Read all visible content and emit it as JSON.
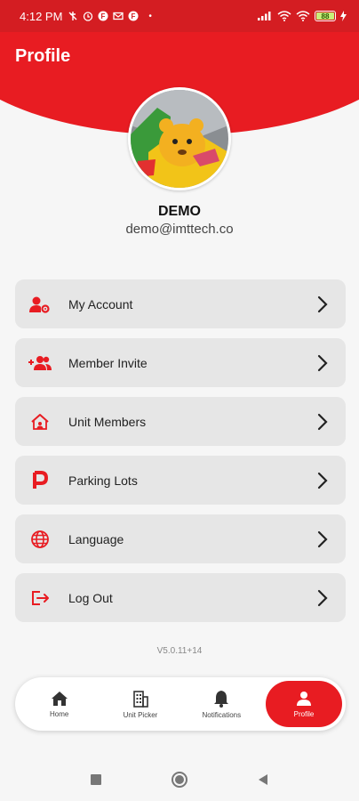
{
  "status_bar": {
    "time": "4:12 PM",
    "battery": "88"
  },
  "header": {
    "title": "Profile"
  },
  "user": {
    "name": "DEMO",
    "email": "demo@imttech.co"
  },
  "menu": [
    {
      "label": "My Account",
      "icon": "user-gear-icon"
    },
    {
      "label": "Member Invite",
      "icon": "add-users-icon"
    },
    {
      "label": "Unit Members",
      "icon": "home-user-icon"
    },
    {
      "label": "Parking Lots",
      "icon": "parking-icon"
    },
    {
      "label": "Language",
      "icon": "globe-icon"
    },
    {
      "label": "Log Out",
      "icon": "logout-icon"
    }
  ],
  "version": "V5.0.11+14",
  "bottom_nav": [
    {
      "label": "Home",
      "icon": "home-icon",
      "active": false
    },
    {
      "label": "Unit Picker",
      "icon": "building-icon",
      "active": false
    },
    {
      "label": "Notifications",
      "icon": "bell-icon",
      "active": false
    },
    {
      "label": "Profile",
      "icon": "person-icon",
      "active": true
    }
  ],
  "colors": {
    "brand_red": "#e81c22",
    "menu_bg": "#e6e6e6",
    "page_bg": "#f6f6f6"
  }
}
